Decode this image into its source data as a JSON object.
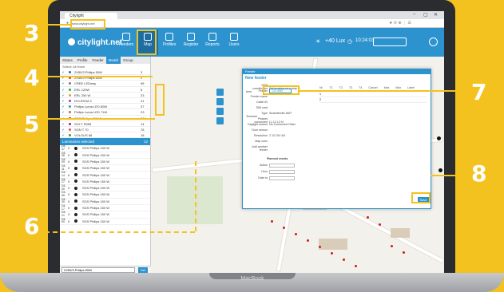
{
  "callouts": [
    "3",
    "4",
    "5",
    "6",
    "7",
    "8"
  ],
  "laptop_label": "MacBook",
  "browser": {
    "tab_title": "Citylight",
    "url": "www.citylight.net",
    "window_controls": [
      "–",
      "▢",
      "✕"
    ]
  },
  "app": {
    "logo": "citylight.net",
    "nav": [
      {
        "label": "Feeders",
        "icon": "feeders-icon"
      },
      {
        "label": "Map",
        "icon": "map-icon",
        "active": true
      },
      {
        "label": "Profiles",
        "icon": "profiles-icon"
      },
      {
        "label": "Register",
        "icon": "register-icon"
      },
      {
        "label": "Reports",
        "icon": "reports-icon"
      },
      {
        "label": "Users",
        "icon": "users-icon"
      }
    ],
    "lux": "+40 Lux",
    "time": "10:24:03",
    "colors": {
      "accent": "#2d93ce",
      "highlight": "#f4c21e"
    }
  },
  "sidebar": {
    "tabs": [
      "Status",
      "Profile",
      "Feeder",
      "Model",
      "Group"
    ],
    "active_tab": "Model",
    "select_line": "Select: All  None",
    "models": [
      {
        "name": "2X50/3 Philips 50W",
        "count": "3",
        "color": "#1f6fd1"
      },
      {
        "name": "2X56/3 Philips 60W",
        "count": "2",
        "color": "#c23a3a"
      },
      {
        "name": "CREE LEDway",
        "count": "98",
        "color": "#7a7a7a"
      },
      {
        "name": "ERL 120W",
        "count": "6",
        "color": "#2da84a"
      },
      {
        "name": "ERL 250 W",
        "count": "23",
        "color": "#e0a020"
      },
      {
        "name": "NYLEDSA 2",
        "count": "41",
        "color": "#9c3ad1"
      },
      {
        "name": "Philips Luma LED 60W",
        "count": "37",
        "color": "#1aa7a7"
      },
      {
        "name": "Philips Luma LED 71W",
        "count": "23",
        "color": "#d16a1f"
      },
      {
        "name": "SGS Philips 150 W",
        "count": "584",
        "color": "#222222"
      },
      {
        "name": "SOI-T R055",
        "count": "14",
        "color": "#b31f6e"
      },
      {
        "name": "SON T 70",
        "count": "78",
        "color": "#e05050"
      },
      {
        "name": "VOLGUS 68",
        "count": "18",
        "color": "#5a8a2a"
      }
    ],
    "luminaires_title": "Luminaires selected",
    "luminaires_count": "12",
    "luminaires": [
      {
        "id": "D4-37",
        "qty": "0",
        "name": "SGS Philips 150 W"
      },
      {
        "id": "D4-06",
        "qty": "0",
        "name": "SGS Philips 150 W"
      },
      {
        "id": "D4-09",
        "qty": "0",
        "name": "SGS Philips 150 W"
      },
      {
        "id": "D4-11",
        "qty": "0",
        "name": "SGS Philips 150 W"
      },
      {
        "id": "D4-14",
        "qty": "0",
        "name": "SGS Philips 150 W"
      },
      {
        "id": "D4-27",
        "qty": "0",
        "name": "SGS Philips 150 W"
      },
      {
        "id": "D4-40",
        "qty": "0",
        "name": "SGS Philips 150 W"
      },
      {
        "id": "D4-55",
        "qty": "0",
        "name": "SGS Philips 150 W"
      },
      {
        "id": "D4-30",
        "qty": "0",
        "name": "SGS Philips 150 W"
      },
      {
        "id": "D4-17",
        "qty": "0",
        "name": "SGS Philips 150 W"
      },
      {
        "id": "D4-21",
        "qty": "0",
        "name": "SGS Philips 150 W"
      },
      {
        "id": "D4-60",
        "qty": "0",
        "name": "SGS Philips 150 W"
      }
    ],
    "footer_select": "2X50/3 Philips 50W",
    "footer_button": "Set"
  },
  "modal": {
    "header": "Feeder",
    "title": "New feeder",
    "fields": [
      {
        "label": "GPS coordinates",
        "value": "Set location on a map ✚ here"
      },
      {
        "label": "Feeder",
        "value": "123 4567"
      },
      {
        "label": "Feeder name",
        "value": ""
      },
      {
        "label": "Cabin ID",
        "value": ""
      },
      {
        "label": "SIM card",
        "value": ""
      },
      {
        "label": "Type",
        "value": "Smartfeeder  AMT Terminal"
      },
      {
        "label": "Phases connected",
        "value": "L1 L2 L3 N"
      },
      {
        "label": "Daylight sensor",
        "value": "No  Connected  Other"
      },
      {
        "label": "Door sensor",
        "value": ""
      },
      {
        "label": "Resolution",
        "value": "2 1/2  3/4  4/4"
      },
      {
        "label": "Map color",
        "value": ""
      },
      {
        "label": "Add another feeder",
        "value": ""
      }
    ],
    "table_headers": [
      "Nr.",
      "T1",
      "T2",
      "T3",
      "T4",
      "Cancel",
      "Max",
      "Max",
      "Label"
    ],
    "phase_rows": [
      "1",
      "2"
    ],
    "planned_header": "Planned events",
    "planned_fields": [
      "Action",
      "Hour",
      "Date to"
    ],
    "save_label": "Save"
  }
}
